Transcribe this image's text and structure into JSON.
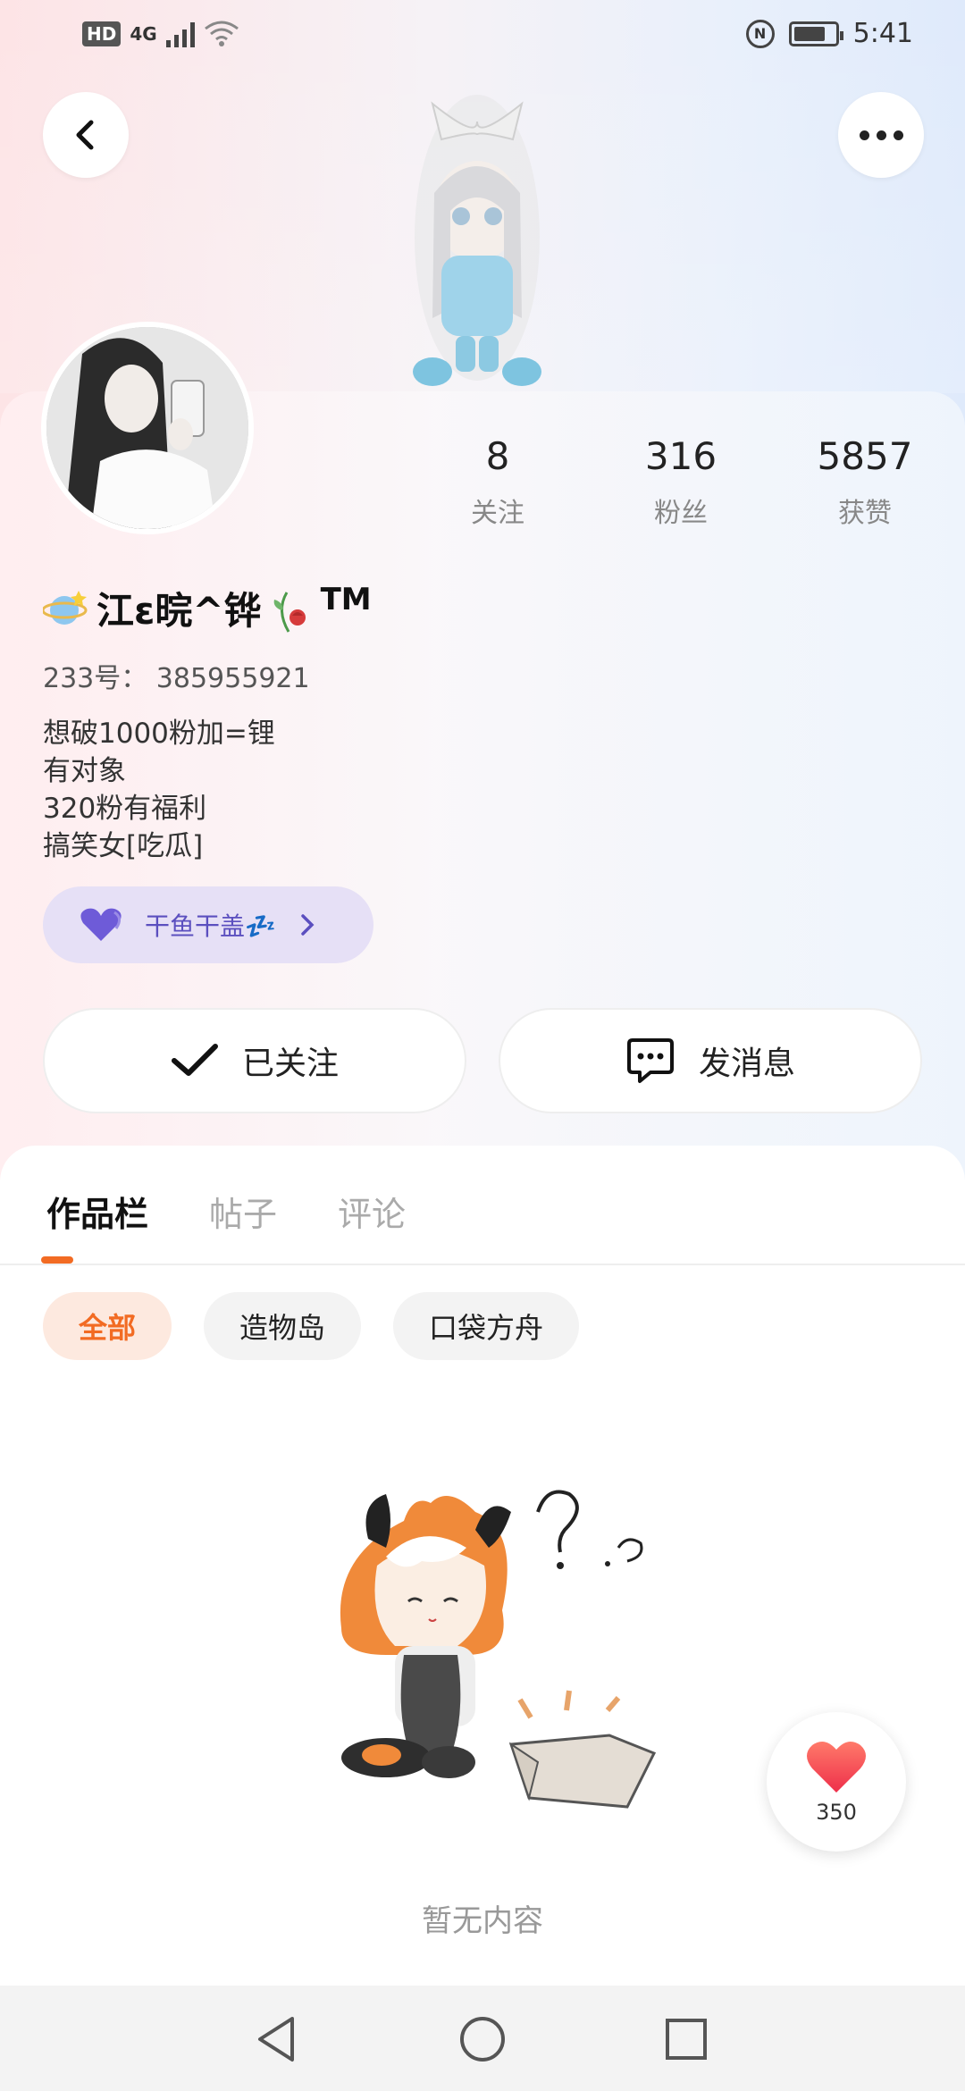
{
  "status_bar": {
    "hd": "HD",
    "network": "4G",
    "nfc": "N",
    "time": "5:41"
  },
  "profile": {
    "stats": [
      {
        "value": "8",
        "label": "关注"
      },
      {
        "value": "316",
        "label": "粉丝"
      },
      {
        "value": "5857",
        "label": "获赞"
      }
    ],
    "name_prefix_icon": "planet-emoji",
    "name": "江ε晥^铧",
    "name_suffix_icon": "wilted-rose-emoji",
    "name_tm": "TM",
    "uid": "233号： 385955921",
    "bio": [
      "想破1000粉加=锂",
      "有对象",
      "320粉有福利",
      "搞笑女[吃瓜]"
    ],
    "fan_group": {
      "label": "干鱼干盖💤",
      "icon": "purple-heart-icon"
    }
  },
  "actions": {
    "follow_label": "已关注",
    "message_label": "发消息"
  },
  "tabs": [
    {
      "label": "作品栏",
      "active": true
    },
    {
      "label": "帖子",
      "active": false
    },
    {
      "label": "评论",
      "active": false
    }
  ],
  "filters": [
    {
      "label": "全部",
      "active": true
    },
    {
      "label": "造物岛",
      "active": false
    },
    {
      "label": "口袋方舟",
      "active": false
    }
  ],
  "empty_state": {
    "text": "暂无内容"
  },
  "floating_like": {
    "count": "350"
  },
  "colors": {
    "accent": "#f26b23",
    "fan_chip_bg": "#e6e0f6",
    "heart": "#f0404a"
  }
}
